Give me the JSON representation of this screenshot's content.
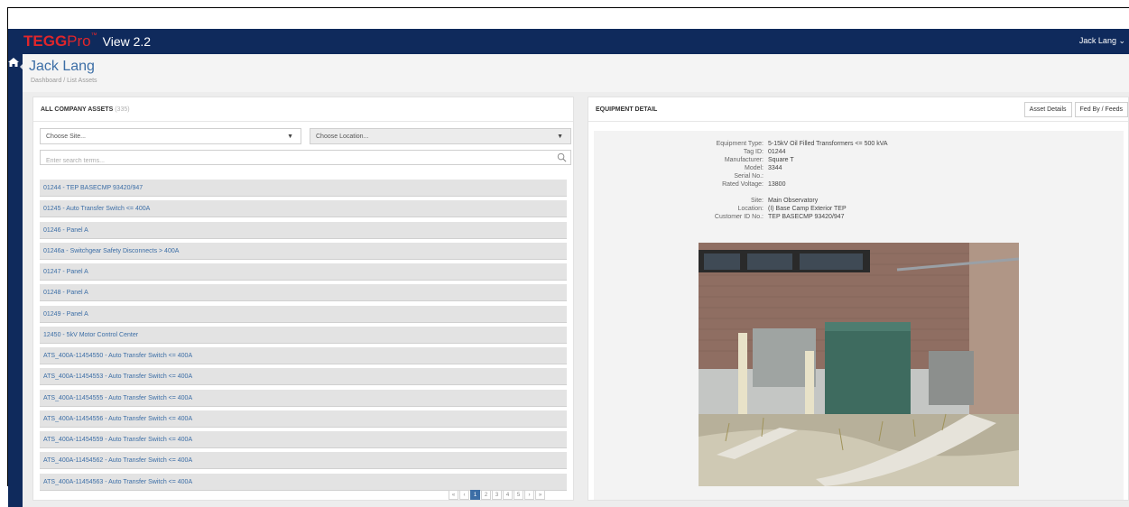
{
  "app": {
    "brand_main": "TEGG",
    "brand_pro": "Pro",
    "brand_tm": "™",
    "brand_version": "View 2.2",
    "user_menu": "Jack Lang ⌄"
  },
  "header": {
    "title": "Jack Lang",
    "breadcrumb_home": "Dashboard",
    "breadcrumb_sep": " / ",
    "breadcrumb_current": "List Assets"
  },
  "left_panel": {
    "title": "ALL COMPANY ASSETS",
    "count": "(335)",
    "site_placeholder": "Choose Site...",
    "location_placeholder": "Choose Location...",
    "search_placeholder": "Enter search terms...",
    "assets": [
      "01244 - TEP BASECMP 93420/947",
      "01245 - Auto Transfer Switch <= 400A",
      "01246 - Panel A",
      "01246a - Switchgear Safety Disconnects > 400A",
      "01247 - Panel A",
      "01248 - Panel A",
      "01249 - Panel A",
      "12450 - 5kV Motor Control Center",
      "ATS_400A-11454550 - Auto Transfer Switch <= 400A",
      "ATS_400A-11454553 - Auto Transfer Switch <= 400A",
      "ATS_400A-11454555 - Auto Transfer Switch <= 400A",
      "ATS_400A-11454556 - Auto Transfer Switch <= 400A",
      "ATS_400A-11454559 - Auto Transfer Switch <= 400A",
      "ATS_400A-11454562 - Auto Transfer Switch <= 400A",
      "ATS_400A-11454563 - Auto Transfer Switch <= 400A"
    ],
    "pagination": [
      "«",
      "‹",
      "1",
      "2",
      "3",
      "4",
      "5",
      "›",
      "»"
    ],
    "current_page": "1"
  },
  "right_panel": {
    "title": "EQUIPMENT DETAIL",
    "btn_asset_details": "Asset Details",
    "btn_fed_by": "Fed By / Feeds",
    "details": {
      "equipment_type_label": "Equipment Type:",
      "equipment_type": "5-15kV Oil Filled Transformers <= 500 kVA",
      "tag_id_label": "Tag ID:",
      "tag_id": "01244",
      "manufacturer_label": "Manufacturer:",
      "manufacturer": "Square T",
      "model_label": "Model:",
      "model": "3344",
      "serial_label": "Serial No.:",
      "serial": "",
      "voltage_label": "Rated Voltage:",
      "voltage": "13800",
      "site_label": "Site:",
      "site": "Main Observatory",
      "location_label": "Location:",
      "location": "(I) Base Camp Exterior TEP",
      "customer_id_label": "Customer ID No.:",
      "customer_id": "TEP BASECMP 93420/947"
    }
  },
  "colors": {
    "navy": "#0f2a5c",
    "brand_red": "#e0262b",
    "link_blue": "#3c6ea6"
  }
}
